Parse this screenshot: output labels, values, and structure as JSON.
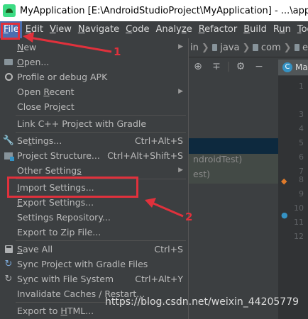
{
  "window": {
    "title": "MyApplication [E:\\AndroidStudioProject\\MyApplication] - ...\\app\\src\\m"
  },
  "menubar": [
    {
      "mn": "F",
      "rest": "ile",
      "active": true
    },
    {
      "mn": "E",
      "rest": "dit"
    },
    {
      "mn": "V",
      "rest": "iew"
    },
    {
      "mn": "N",
      "rest": "avigate"
    },
    {
      "mn": "C",
      "rest": "ode"
    },
    {
      "pre": "Analy",
      "mn": "z",
      "rest": "e"
    },
    {
      "mn": "R",
      "rest": "efactor"
    },
    {
      "mn": "B",
      "rest": "uild"
    },
    {
      "pre": "R",
      "mn": "u",
      "rest": "n"
    },
    {
      "mn": "T",
      "rest": "oo"
    }
  ],
  "breadcrumb": {
    "p1": "in",
    "p2": "java",
    "p3": "com",
    "p4": "e"
  },
  "editor_tab": {
    "badge": "C",
    "label": "Ma"
  },
  "tree": {
    "line1": "ndroidTest)",
    "line2": "est)"
  },
  "gutter": {
    "lines": [
      "1",
      "3",
      "4",
      "5",
      "6",
      "7",
      "8",
      "9",
      "10",
      "11",
      "12"
    ]
  },
  "menu": {
    "new": {
      "pre": "",
      "mn": "N",
      "rest": "ew"
    },
    "open": {
      "pre": "",
      "mn": "O",
      "rest": "pen..."
    },
    "profile": "Profile or debug APK",
    "open_recent": {
      "pre": "Open ",
      "mn": "R",
      "rest": "ecent"
    },
    "close_project": {
      "pre": "Close Pro",
      "mn": "j",
      "rest": "ect"
    },
    "link_cpp": "Link C++ Project with Gradle",
    "settings": {
      "pre": "Se",
      "mn": "t",
      "rest": "tings...",
      "shortcut": "Ctrl+Alt+S"
    },
    "project_structure": {
      "label": "Project Structure...",
      "shortcut": "Ctrl+Alt+Shift+S"
    },
    "other_settings": {
      "pre": "Other Setting",
      "mn": "s",
      "rest": ""
    },
    "import_settings": {
      "pre": "",
      "mn": "I",
      "rest": "mport Settings..."
    },
    "export_settings": {
      "pre": "",
      "mn": "E",
      "rest": "xport Settings..."
    },
    "settings_repository": "Settings Repository...",
    "export_zip": "Export to Zip File...",
    "save_all": {
      "pre": "",
      "mn": "S",
      "rest": "ave All",
      "shortcut": "Ctrl+S"
    },
    "sync_gradle": "Sync Project with Gradle Files",
    "sync_fs": {
      "pre": "S",
      "mn": "y",
      "rest": "nc with File System",
      "shortcut": "Ctrl+Alt+Y"
    },
    "invalidate": "Invalidate Caches / Restart...",
    "export_html": {
      "pre": "Export to ",
      "mn": "H",
      "rest": "TML..."
    }
  },
  "annotations": {
    "n1": "1",
    "n2": "2"
  },
  "watermark": "https://blog.csdn.net/weixin_44205779",
  "colors": {
    "accent": "#4b6eaf",
    "annotation": "#e0313c"
  }
}
